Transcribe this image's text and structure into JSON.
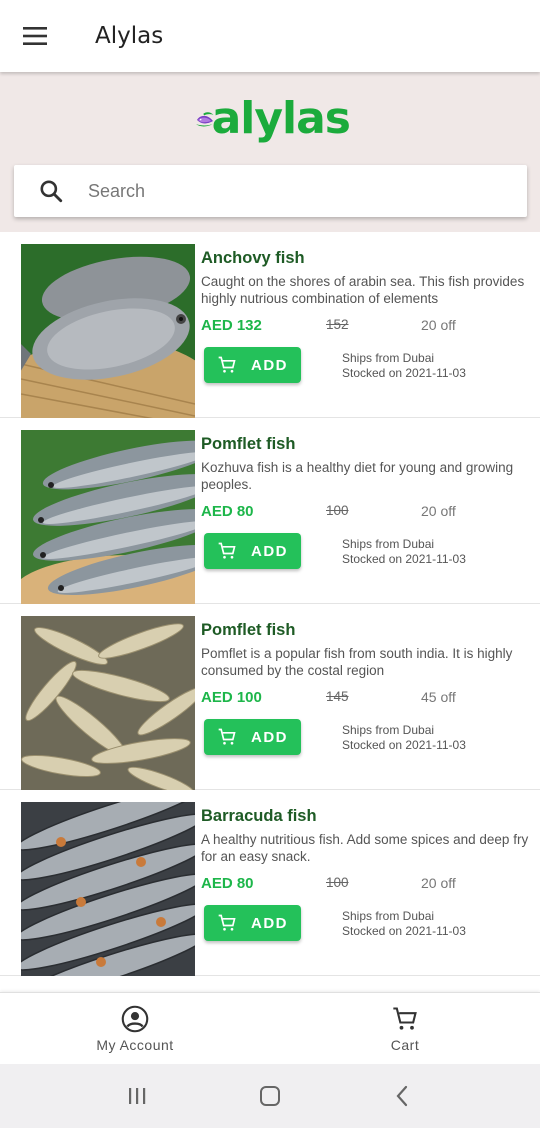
{
  "app": {
    "title": "Alylas",
    "logo_text": "alylas",
    "accent_color": "#24c15a",
    "brand_color": "#1bab3c"
  },
  "search": {
    "placeholder": "Search",
    "value": ""
  },
  "add_label": "ADD",
  "products": [
    {
      "name": "Anchovy fish",
      "description": "Caught on the shores of arabin sea. This fish provides highly nutrious combination of elements",
      "price": "AED 132",
      "mrp": "152",
      "discount": "20 off",
      "ships_from": "Ships from Dubai",
      "stocked_on": "Stocked on 2021-11-03",
      "image": "pomfret-basket"
    },
    {
      "name": "Pomflet fish",
      "description": "Kozhuva fish is a healthy diet for young and growing peoples.",
      "price": "AED 80",
      "mrp": "100",
      "discount": "20 off",
      "ships_from": "Ships from Dubai",
      "stocked_on": "Stocked on 2021-11-03",
      "image": "mullet-row"
    },
    {
      "name": "Pomflet fish",
      "description": "Pomflet is a popular fish from south india. It is highly consumed by the costal region",
      "price": "AED 100",
      "mrp": "145",
      "discount": "45 off",
      "ships_from": "Ships from Dubai",
      "stocked_on": "Stocked on 2021-11-03",
      "image": "small-fish-pile"
    },
    {
      "name": "Barracuda fish",
      "description": "A healthy nutritious fish. Add some spices and deep fry for an easy snack.",
      "price": "AED 80",
      "mrp": "100",
      "discount": "20 off",
      "ships_from": "Ships from Dubai",
      "stocked_on": "Stocked on 2021-11-03",
      "image": "sardine-stack"
    }
  ],
  "bottom_nav": [
    {
      "label": "My Account",
      "icon": "account-circle-icon"
    },
    {
      "label": "Cart",
      "icon": "cart-icon"
    }
  ],
  "system_nav": [
    "recents-icon",
    "home-icon",
    "back-icon"
  ]
}
